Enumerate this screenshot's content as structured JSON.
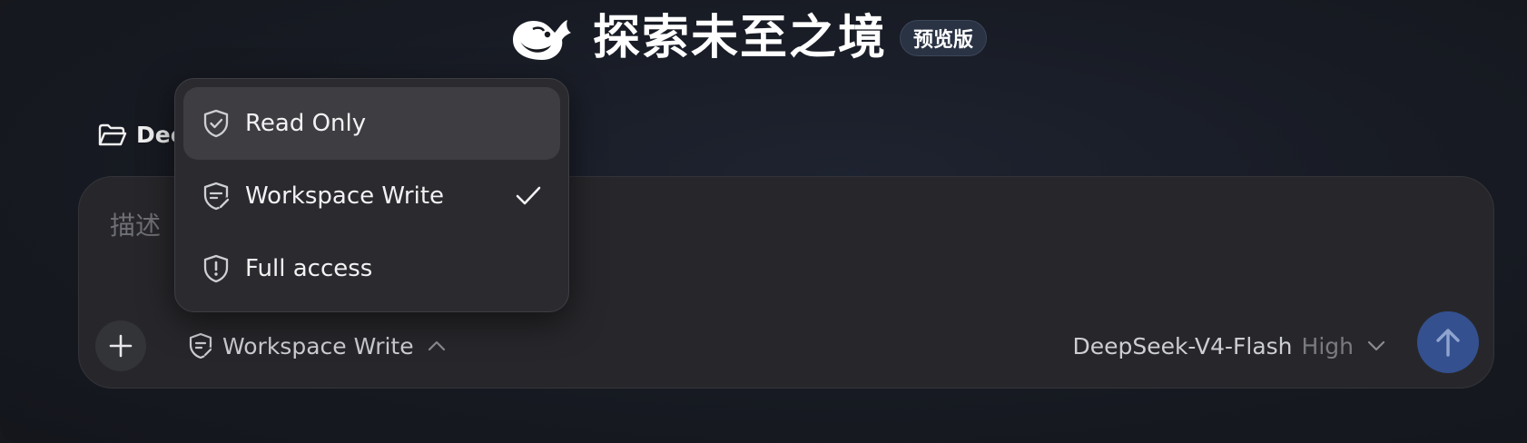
{
  "header": {
    "logo_icon": "whale-logo-icon",
    "title": "探索未至之境",
    "badge": "预览版"
  },
  "folder": {
    "icon": "folder-open-icon",
    "label": "Dee"
  },
  "composer": {
    "placeholder": "描述",
    "add_icon": "plus-icon",
    "mode": {
      "label": "Workspace Write",
      "icon": "shield-edit-icon",
      "chevron": "chevron-up-icon"
    },
    "model": {
      "name": "DeepSeek-V4-Flash",
      "effort": "High",
      "chevron": "chevron-down-icon"
    },
    "send_icon": "arrow-up-icon"
  },
  "permission_menu": {
    "items": [
      {
        "label": "Read Only",
        "icon": "shield-check-icon",
        "highlighted": true,
        "selected": false
      },
      {
        "label": "Workspace Write",
        "icon": "shield-edit-icon",
        "highlighted": false,
        "selected": true
      },
      {
        "label": "Full access",
        "icon": "shield-alert-icon",
        "highlighted": false,
        "selected": false
      }
    ]
  },
  "colors": {
    "background": "#16181e",
    "composer": "#27272b",
    "menu": "#2b2b2f",
    "menu_highlight": "#3e3e42",
    "send_button": "#34508f",
    "badge": "#2a3344"
  }
}
